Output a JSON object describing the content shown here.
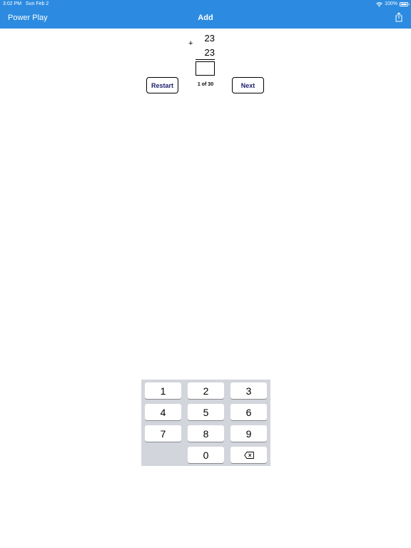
{
  "status_bar": {
    "time": "3:02 PM",
    "date": "Sun Feb 2",
    "battery": "100%",
    "battery_level": 1.0
  },
  "nav": {
    "back_label": "Power Play",
    "title": "Add",
    "share_icon": "share-icon"
  },
  "problem": {
    "top_number": "23",
    "bottom_number": "23",
    "operator": "+",
    "answer": ""
  },
  "controls": {
    "restart_label": "Restart",
    "next_label": "Next",
    "progress": "1 of 30"
  },
  "keypad": {
    "keys": [
      "1",
      "2",
      "3",
      "4",
      "5",
      "6",
      "7",
      "8",
      "9",
      "0"
    ],
    "backspace_icon": "backspace-icon"
  },
  "colors": {
    "nav_background": "#2c8be0",
    "keypad_background": "#d2d5db",
    "button_text": "#1c1c6b"
  }
}
